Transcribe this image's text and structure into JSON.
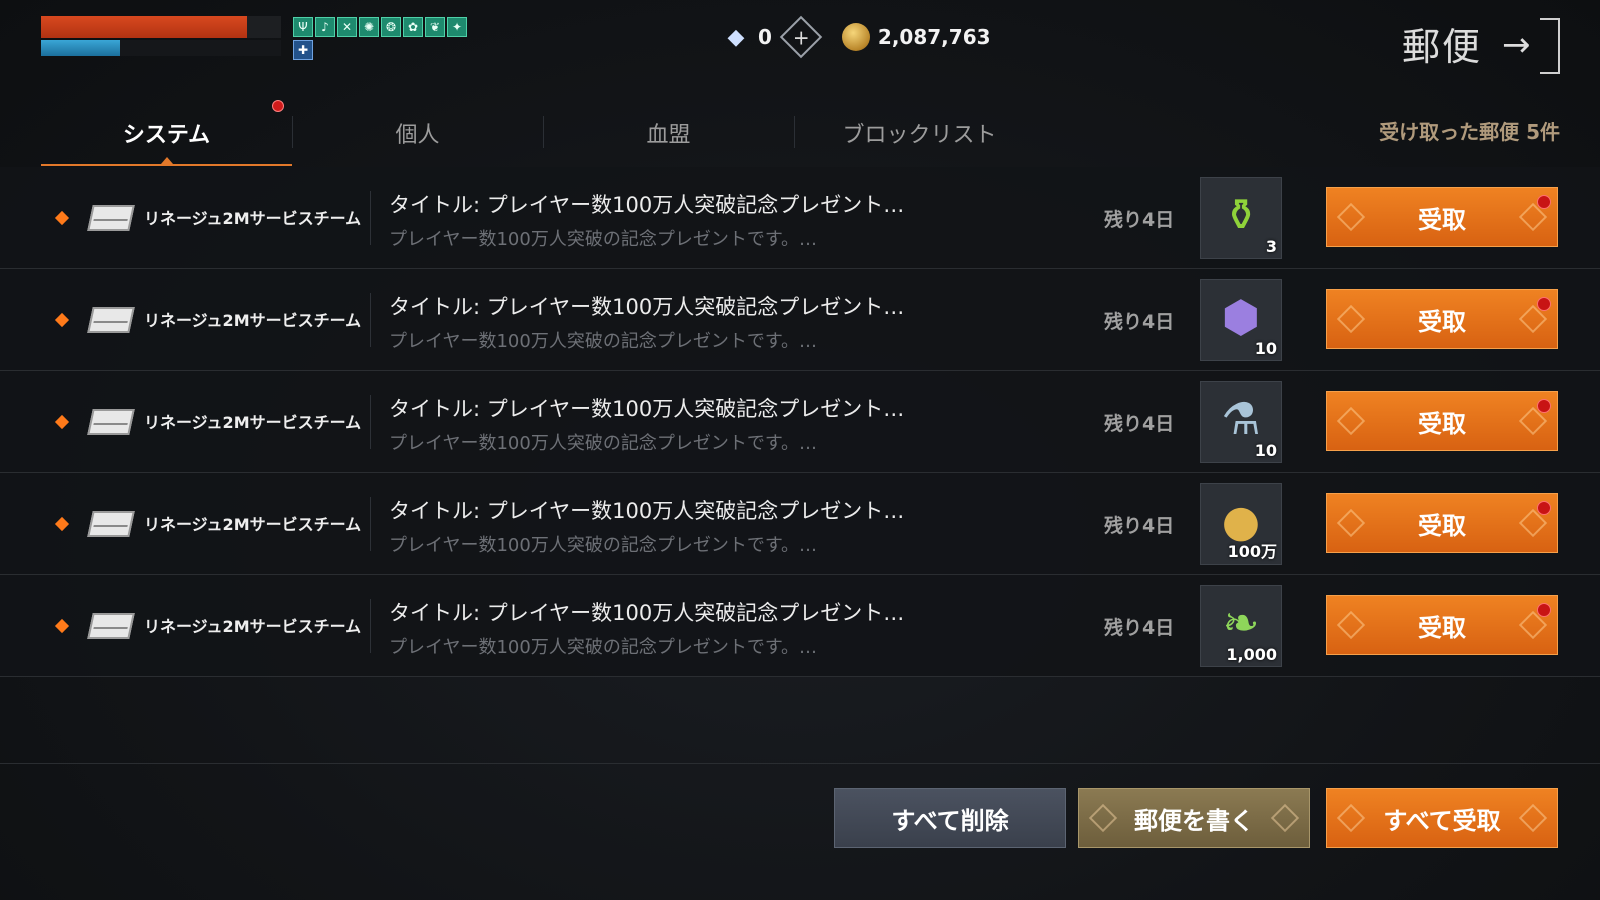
{
  "hud": {
    "hp_fraction": 0.86,
    "mp_fraction": 0.33
  },
  "currency": {
    "diamond": "0",
    "gold": "2,087,763"
  },
  "header": {
    "title": "郵便"
  },
  "tabs": [
    {
      "label": "システム",
      "active": true,
      "badge": true
    },
    {
      "label": "個人"
    },
    {
      "label": "血盟"
    },
    {
      "label": "ブロックリスト"
    }
  ],
  "mail_count": "受け取った郵便 5件",
  "mails": [
    {
      "sender": "リネージュ2Mサービスチーム",
      "title": "タイトル: プレイヤー数100万人突破記念プレゼント…",
      "body": "プレイヤー数100万人突破の記念プレゼントです。…",
      "remaining": "残り4日",
      "item_icon": "green-potion-icon",
      "quantity": "3",
      "button": "受取"
    },
    {
      "sender": "リネージュ2Mサービスチーム",
      "title": "タイトル: プレイヤー数100万人突破記念プレゼント…",
      "body": "プレイヤー数100万人突破の記念プレゼントです。…",
      "remaining": "残り4日",
      "item_icon": "purple-crystal-icon",
      "quantity": "10",
      "button": "受取"
    },
    {
      "sender": "リネージュ2Mサービスチーム",
      "title": "タイトル: プレイヤー数100万人突破記念プレゼント…",
      "body": "プレイヤー数100万人突破の記念プレゼントです。…",
      "remaining": "残り4日",
      "item_icon": "blue-vial-icon",
      "quantity": "10",
      "button": "受取"
    },
    {
      "sender": "リネージュ2Mサービスチーム",
      "title": "タイトル: プレイヤー数100万人突破記念プレゼント…",
      "body": "プレイヤー数100万人突破の記念プレゼントです。…",
      "remaining": "残り4日",
      "item_icon": "gold-coin-icon",
      "quantity": "100万",
      "button": "受取"
    },
    {
      "sender": "リネージュ2Mサービスチーム",
      "title": "タイトル: プレイヤー数100万人突破記念プレゼント…",
      "body": "プレイヤー数100万人突破の記念プレゼントです。…",
      "remaining": "残り4日",
      "item_icon": "green-feather-icon",
      "quantity": "1,000",
      "button": "受取"
    }
  ],
  "footer": {
    "delete_all": "すべて削除",
    "write_mail": "郵便を書く",
    "receive_all": "すべて受取"
  },
  "colors": {
    "accent": "#e2782a",
    "button_orange": "#e2721a",
    "badge_red": "#d01b1b"
  }
}
